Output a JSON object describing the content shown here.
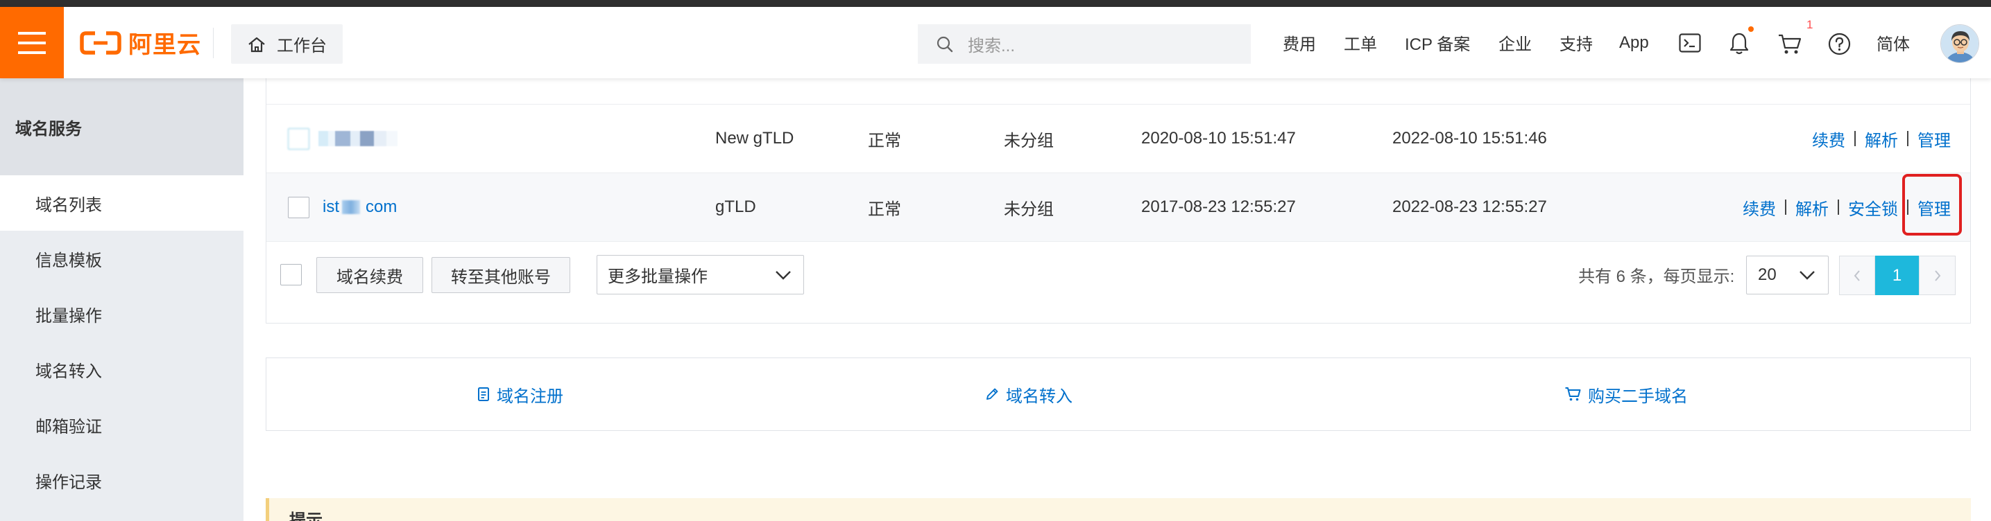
{
  "header": {
    "logo_text": "阿里云",
    "workbench_label": "工作台",
    "search_placeholder": "搜索...",
    "nav": [
      "费用",
      "工单",
      "ICP 备案",
      "企业",
      "支持",
      "App"
    ],
    "cart_badge": "1",
    "language": "简体",
    "icons": [
      "menu-icon",
      "logo-icon",
      "home-icon",
      "search-icon",
      "terminal-icon",
      "bell-icon",
      "cart-icon",
      "help-icon",
      "avatar"
    ]
  },
  "sidebar": {
    "title": "域名服务",
    "items": [
      {
        "label": "域名列表",
        "active": true
      },
      {
        "label": "信息模板",
        "active": false
      },
      {
        "label": "批量操作",
        "active": false
      },
      {
        "label": "域名转入",
        "active": false
      },
      {
        "label": "邮箱验证",
        "active": false
      },
      {
        "label": "操作记录",
        "active": false
      }
    ]
  },
  "domain_table": {
    "rows": [
      {
        "domain_redacted": true,
        "type": "New gTLD",
        "status": "正常",
        "group": "未分组",
        "registered_at": "2020-08-10 15:51:47",
        "expires_at": "2022-08-10 15:51:46",
        "actions": [
          "续费",
          "解析",
          "管理"
        ]
      },
      {
        "domain_prefix": "ist",
        "domain_suffix": "com",
        "domain_partially_redacted": true,
        "type": "gTLD",
        "status": "正常",
        "group": "未分组",
        "registered_at": "2017-08-23 12:55:27",
        "expires_at": "2022-08-23 12:55:27",
        "actions": [
          "续费",
          "解析",
          "安全锁",
          "管理"
        ],
        "highlighted_action_index": 3
      }
    ],
    "footer": {
      "bulk_buttons": [
        "域名续费",
        "转至其他账号"
      ],
      "more_actions_select": "更多批量操作",
      "total_label": "共有 6 条，每页显示:",
      "page_size": "20",
      "current_page": "1"
    }
  },
  "quick_links": [
    {
      "label": "域名注册",
      "icon": "document-icon"
    },
    {
      "label": "域名转入",
      "icon": "pencil-icon"
    },
    {
      "label": "购买二手域名",
      "icon": "cart-icon"
    }
  ],
  "notice": {
    "title": "提示"
  },
  "colors": {
    "brand_orange": "#ff6a00",
    "link_blue": "#0070cc",
    "pagination_active": "#1eb8dc",
    "highlight_red": "#e02020",
    "notice_bg": "#fdf6e3"
  }
}
